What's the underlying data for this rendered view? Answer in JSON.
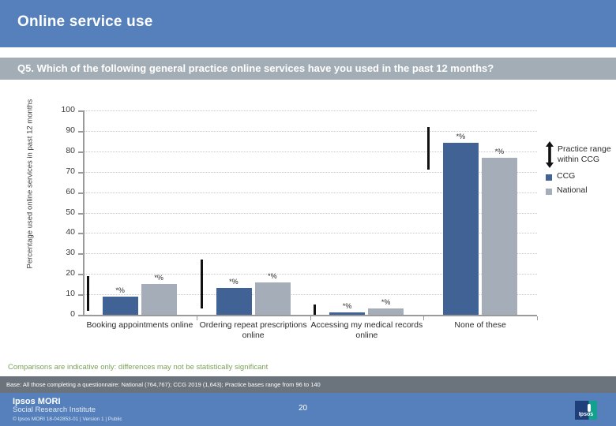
{
  "header": {
    "title": "Online service use"
  },
  "question": {
    "text": "Q5. Which of the following general practice online services have you used in the past 12 months?"
  },
  "legend": {
    "range_label": "Practice range within CCG",
    "range_icon": "up-down-arrow-icon",
    "items": [
      {
        "label": "CCG",
        "color": "#406295"
      },
      {
        "label": "National",
        "color": "#a5adb8"
      }
    ]
  },
  "notes": {
    "comparison": "Comparisons are indicative only: differences may not be statistically significant",
    "base": "Base: All those completing a questionnaire: National (764,767); CCG 2019 (1,643); Practice bases range from 96 to 140"
  },
  "footer": {
    "brand": "Ipsos MORI",
    "brand_sub": "Social Research Institute",
    "copyright": "© Ipsos MORI      18-042853-01 | Version 1 | Public",
    "slide_number": "20",
    "logo_text": "Ipsos"
  },
  "chart_data": {
    "type": "bar",
    "title": "Q5. Which of the following general practice online services have you used in the past 12 months?",
    "xlabel": "",
    "ylabel": "Percentage used online services in past 12 months",
    "ylim": [
      0,
      100
    ],
    "yticks": [
      0,
      10,
      20,
      30,
      40,
      50,
      60,
      70,
      80,
      90,
      100
    ],
    "grid": true,
    "legend_position": "right",
    "categories": [
      "Booking appointments online",
      "Ordering repeat prescriptions online",
      "Accessing my medical records online",
      "None of these"
    ],
    "series": [
      {
        "name": "CCG",
        "color": "#406295",
        "values": [
          9,
          13,
          1,
          84
        ],
        "labels": [
          "*%",
          "*%",
          "*%",
          "*%"
        ]
      },
      {
        "name": "National",
        "color": "#a5adb8",
        "values": [
          15,
          16,
          3,
          77
        ],
        "labels": [
          "*%",
          "*%",
          "*%",
          "*%"
        ]
      }
    ],
    "practice_range": {
      "name": "Practice range within CCG",
      "color": "#111111",
      "ranges": [
        {
          "low": 2,
          "high": 19
        },
        {
          "low": 3,
          "high": 27
        },
        {
          "low": 0,
          "high": 5
        },
        {
          "low": 71,
          "high": 92
        }
      ]
    }
  }
}
